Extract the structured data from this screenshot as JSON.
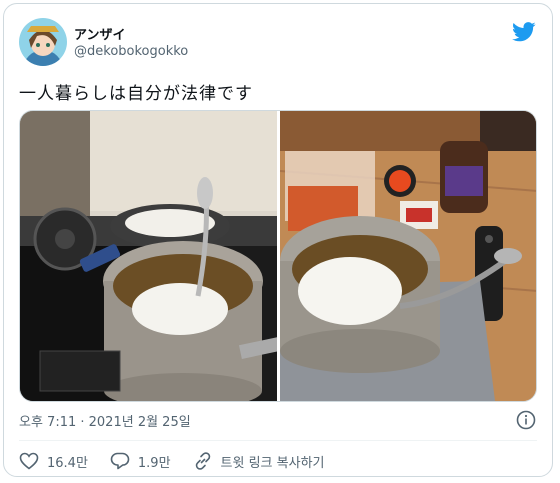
{
  "user": {
    "display_name": "アンザイ",
    "handle": "@dekobokogokko"
  },
  "tweet": {
    "text": "一人暮らしは自分が法律です"
  },
  "meta": {
    "timestamp": "오후 7:11 · 2021년 2월 25일"
  },
  "actions": {
    "likes": "16.4만",
    "replies": "1.9만",
    "copy_link": "트윗 링크 복사하기"
  },
  "colors": {
    "brand": "#1d9bf0",
    "text": "#0f1419",
    "secondary": "#536471",
    "border": "#cfd9de"
  },
  "icons": {
    "brand": "twitter-bird-icon",
    "info": "info-icon",
    "like": "heart-icon",
    "reply": "reply-icon",
    "link": "link-icon"
  }
}
